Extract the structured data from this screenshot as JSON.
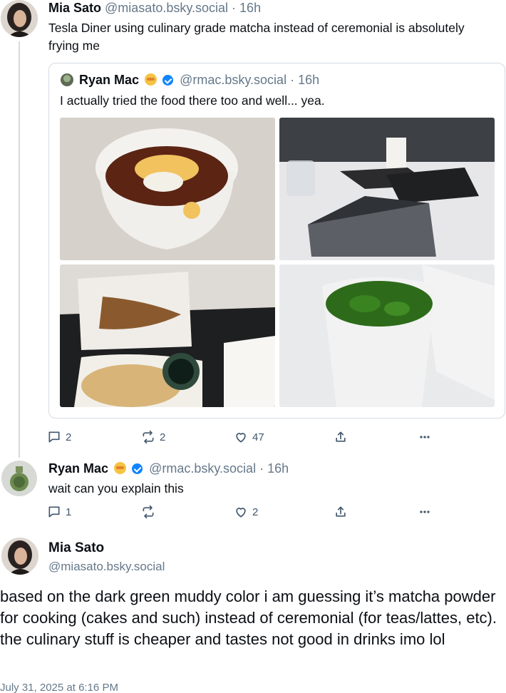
{
  "post1": {
    "author_name": "Mia Sato",
    "author_handle": "@miasato.bsky.social",
    "time": "· 16h",
    "text": "Tesla Diner using culinary grade matcha instead of ceremonial is absolutely frying me",
    "quote": {
      "author_name": "Ryan Mac",
      "author_handle": "@rmac.bsky.social",
      "time": "· 16h",
      "text": "I actually tried the food there too and well... yea."
    },
    "actions": {
      "replies": "2",
      "reposts": "2",
      "likes": "47"
    }
  },
  "post2": {
    "author_name": "Ryan Mac",
    "author_handle": "@rmac.bsky.social",
    "time": "· 16h",
    "text": "wait can you explain this",
    "actions": {
      "replies": "1",
      "reposts": "",
      "likes": "2"
    }
  },
  "post3": {
    "author_name": "Mia Sato",
    "author_handle": "@miasato.bsky.social",
    "text": "based on the dark green muddy color i am guessing it’s matcha powder for cooking (cakes and such) instead of ceremonial (for teas/lattes, etc). the culinary stuff is cheaper and tastes not good in drinks imo lol",
    "timestamp": "July 31, 2025 at 6:16 PM"
  },
  "icons": {
    "reply": "speech-bubble-icon",
    "repost": "repost-arrows-icon",
    "like": "heart-icon",
    "share": "share-icon",
    "more": "ellipsis-icon"
  },
  "colors": {
    "accent": "#1185fe",
    "muted": "#66788a",
    "icon": "#42576c"
  }
}
